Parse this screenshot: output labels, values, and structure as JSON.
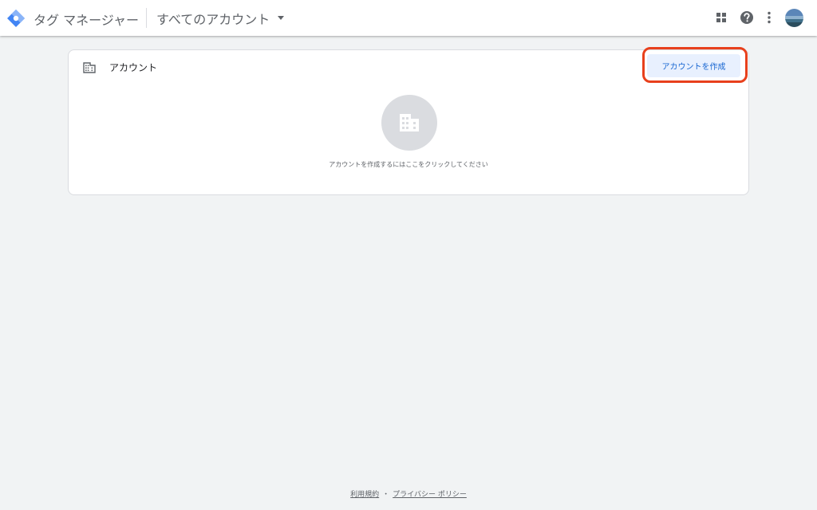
{
  "header": {
    "product_name": "タグ マネージャー",
    "account_picker_label": "すべてのアカウント"
  },
  "accounts_card": {
    "title": "アカウント",
    "create_button_label": "アカウントを作成",
    "empty_state_text": "アカウントを作成するにはここをクリックしてください"
  },
  "footer": {
    "terms_link": "利用規約",
    "separator": "・",
    "privacy_link": "プライバシー ポリシー"
  },
  "icons": {
    "logo": "tag-manager-logo",
    "dropdown": "caret-down-icon",
    "apps": "apps-grid-icon",
    "help": "help-icon",
    "more": "more-vert-icon",
    "account": "building-icon"
  },
  "colors": {
    "logo_blue": "#4285f4",
    "button_bg": "#e8f0fe",
    "button_text": "#1967d2",
    "highlight": "#e8401c",
    "page_bg": "#f1f3f4"
  }
}
